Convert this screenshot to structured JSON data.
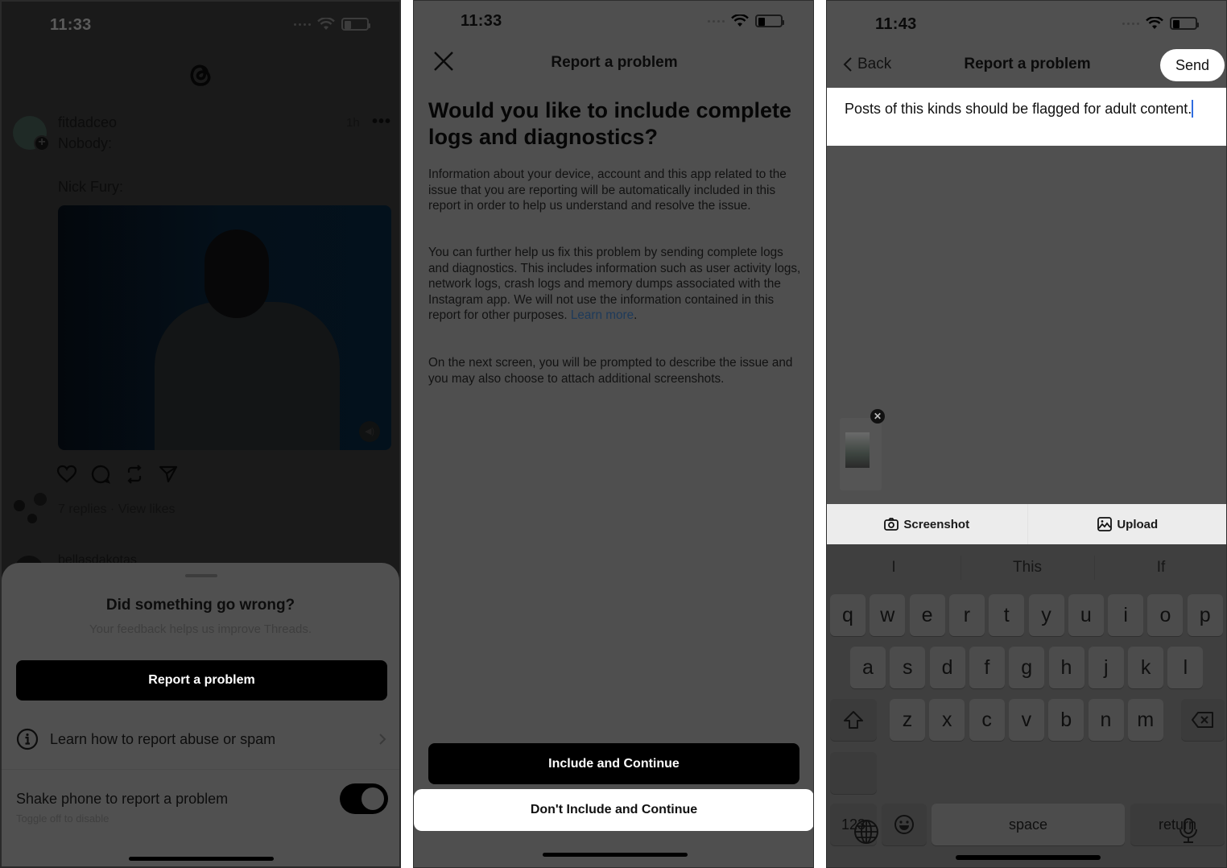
{
  "panel1": {
    "status": {
      "time": "11:33"
    },
    "app_logo": "threads-logo",
    "post": {
      "username": "fitdadceo",
      "timestamp": "1h",
      "lines": [
        "Nobody:",
        "Nick Fury:"
      ],
      "replies": "7 replies · View likes",
      "actions": [
        "heart-icon",
        "comment-icon",
        "repost-icon",
        "share-icon"
      ]
    },
    "next_post": {
      "username": "bellasdakotas"
    },
    "sheet": {
      "title": "Did something go wrong?",
      "subtitle": "Your feedback helps us improve Threads.",
      "report_button": "Report a problem",
      "learn_label": "Learn how to report abuse or spam",
      "shake_label": "Shake phone to report a problem",
      "shake_sub": "Toggle off to disable",
      "shake_enabled": true
    }
  },
  "panel2": {
    "status": {
      "time": "11:33"
    },
    "title": "Report a problem",
    "heading": "Would you like to include complete logs and diagnostics?",
    "para1": "Information about your device, account and this app related to the issue that you are reporting will be automatically included in this report in order to help us understand and resolve the issue.",
    "para2": "You can further help us fix this problem by sending complete logs and diagnostics. This includes information such as user activity logs, network logs, crash logs and memory dumps associated with the Instagram app. We will not use the information contained in this report for other purposes.",
    "learn_more": "Learn more",
    "para2_end": ".",
    "para3": "On the next screen, you will be prompted to describe the issue and you may also choose to attach additional screenshots.",
    "include_button": "Include and Continue",
    "dont_include_button": "Don't Include and Continue"
  },
  "panel3": {
    "status": {
      "time": "11:43"
    },
    "back_label": "Back",
    "title": "Report a problem",
    "send_label": "Send",
    "report_text": "Posts of this kinds should be flagged for adult content.",
    "attach": {
      "screenshot_label": "Screenshot",
      "upload_label": "Upload"
    },
    "keyboard": {
      "suggestions": [
        "I",
        "This",
        "If"
      ],
      "row1": [
        "q",
        "w",
        "e",
        "r",
        "t",
        "y",
        "u",
        "i",
        "o",
        "p"
      ],
      "row2": [
        "a",
        "s",
        "d",
        "f",
        "g",
        "h",
        "j",
        "k",
        "l"
      ],
      "row3": [
        "z",
        "x",
        "c",
        "v",
        "b",
        "n",
        "m"
      ],
      "numbers_label": "123",
      "space_label": "space",
      "return_label": "return"
    }
  },
  "colors": {
    "link_blue": "#1e3a5a",
    "caret_blue": "#2f6de0",
    "dim_overlay_bg": "#4f4f4f",
    "feed_bg": "#1a1a1a"
  }
}
